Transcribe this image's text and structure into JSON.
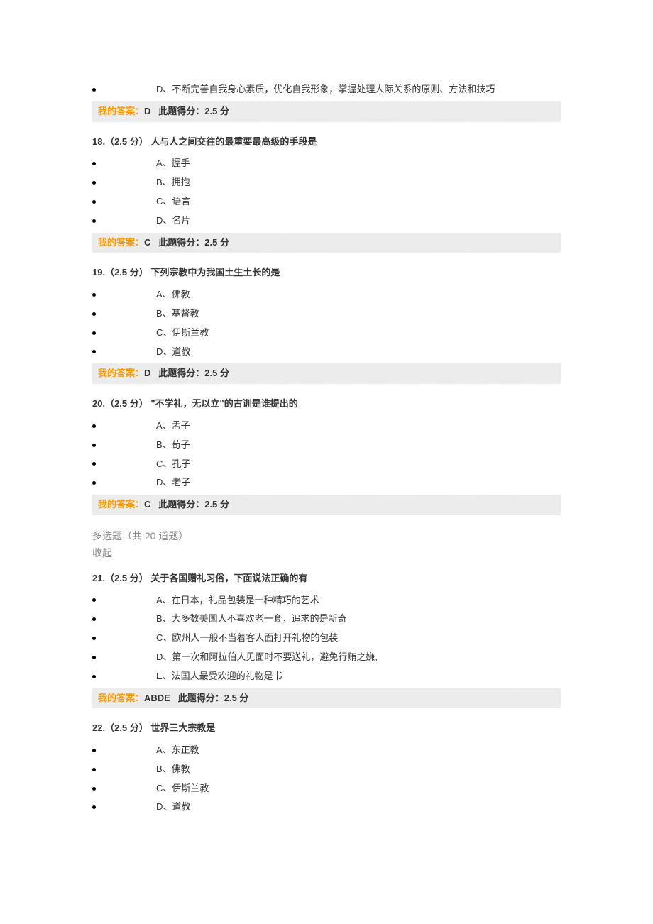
{
  "q17_continued": {
    "options": [
      {
        "label": "D、",
        "text": "不断完善自我身心素质，优化自我形象，掌握处理人际关系的原则、方法和技巧"
      }
    ],
    "answer_label": "我的答案：",
    "answer_value": "D",
    "score_label": "此题得分：",
    "score_value": "2.5 分"
  },
  "q18": {
    "title": "18.（2.5 分）  人与人之间交往的最重要最高级的手段是",
    "options": [
      {
        "label": "A、",
        "text": "握手"
      },
      {
        "label": "B、",
        "text": "拥抱"
      },
      {
        "label": "C、",
        "text": "语言"
      },
      {
        "label": "D、",
        "text": "名片"
      }
    ],
    "answer_label": "我的答案：",
    "answer_value": "C",
    "score_label": "此题得分：",
    "score_value": "2.5 分"
  },
  "q19": {
    "title": "19.（2.5 分）  下列宗教中为我国土生土长的是",
    "options": [
      {
        "label": "A、",
        "text": "佛教"
      },
      {
        "label": "B、",
        "text": "基督教"
      },
      {
        "label": "C、",
        "text": "伊斯兰教"
      },
      {
        "label": "D、",
        "text": "道教"
      }
    ],
    "answer_label": "我的答案：",
    "answer_value": "D",
    "score_label": "此题得分：",
    "score_value": "2.5 分"
  },
  "q20": {
    "title": "20.（2.5 分）  \"不学礼，无以立\"的古训是谁提出的",
    "options": [
      {
        "label": "A、",
        "text": "孟子"
      },
      {
        "label": "B、",
        "text": "荀子"
      },
      {
        "label": "C、",
        "text": "孔子"
      },
      {
        "label": "D、",
        "text": "老子"
      }
    ],
    "answer_label": "我的答案：",
    "answer_value": "C",
    "score_label": "此题得分：",
    "score_value": "2.5 分"
  },
  "section": {
    "title": "多选题（共 20 道题）",
    "collapse": "收起"
  },
  "q21": {
    "title": "21.（2.5 分）  关于各国赠礼习俗，下面说法正确的有",
    "options": [
      {
        "label": "A、",
        "text": "在日本，礼品包装是一种精巧的艺术"
      },
      {
        "label": "B、",
        "text": "大多数美国人不喜欢老一套，追求的是新奇"
      },
      {
        "label": "C、",
        "text": "欧州人一般不当着客人面打开礼物的包装"
      },
      {
        "label": "D、",
        "text": "第一次和阿拉伯人见面时不要送礼，避免行贿之嫌,"
      },
      {
        "label": "E、",
        "text": "法国人最受欢迎的礼物是书"
      }
    ],
    "answer_label": "我的答案：",
    "answer_value": "ABDE",
    "score_label": "此题得分：",
    "score_value": "2.5 分"
  },
  "q22": {
    "title": "22.（2.5 分）  世界三大宗教是",
    "options": [
      {
        "label": "A、",
        "text": "东正教"
      },
      {
        "label": "B、",
        "text": "佛教"
      },
      {
        "label": "C、",
        "text": "伊斯兰教"
      },
      {
        "label": "D、",
        "text": "道教"
      }
    ]
  }
}
